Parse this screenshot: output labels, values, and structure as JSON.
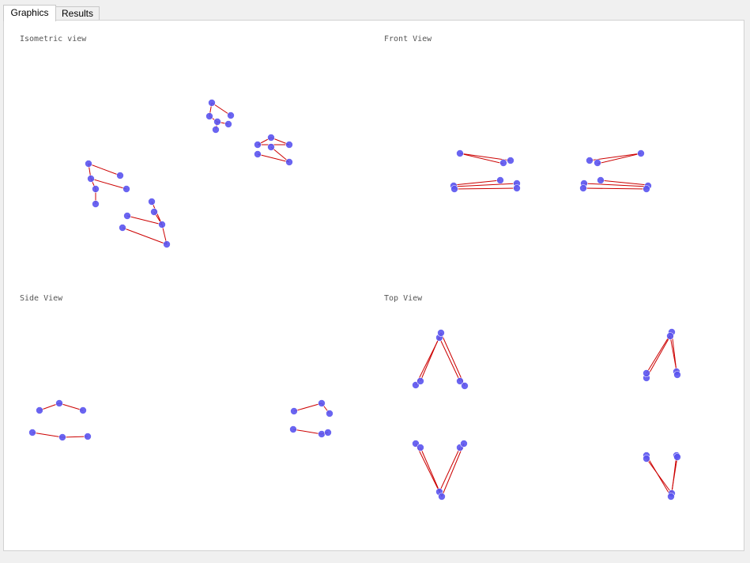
{
  "tabs": [
    {
      "label": "Graphics",
      "active": true
    },
    {
      "label": "Results",
      "active": false
    }
  ],
  "views": {
    "isometric": "Isometric view",
    "front": "Front View",
    "side": "Side View",
    "top": "Top View"
  },
  "colors": {
    "point": "#5a54f0",
    "line": "#cc0000",
    "panel_border": "#d2d2d2",
    "label": "#555555"
  }
}
